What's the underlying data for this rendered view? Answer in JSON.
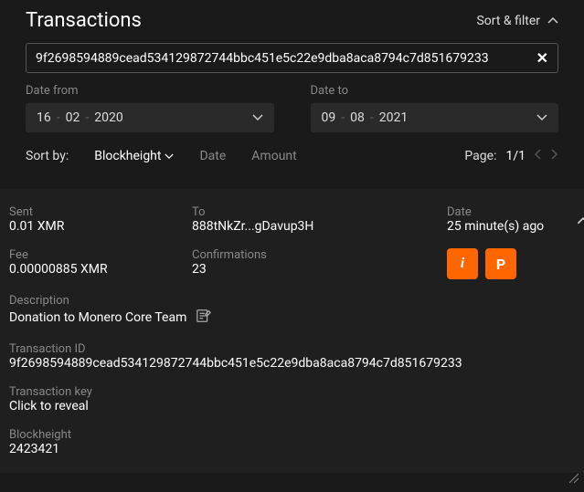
{
  "header": {
    "title": "Transactions",
    "sortFilter": "Sort & filter"
  },
  "search": {
    "value": "9f2698594889cead534129872744bbc451e5c22e9dba8aca8794c7d851679233"
  },
  "dateFrom": {
    "label": "Date from",
    "day": "16",
    "month": "02",
    "year": "2020"
  },
  "dateTo": {
    "label": "Date to",
    "day": "09",
    "month": "08",
    "year": "2021"
  },
  "sort": {
    "label": "Sort by:",
    "options": {
      "blockheight": "Blockheight",
      "date": "Date",
      "amount": "Amount"
    }
  },
  "page": {
    "label": "Page:",
    "value": "1/1"
  },
  "tx": {
    "sentLabel": "Sent",
    "sentValue": "0.01 XMR",
    "toLabel": "To",
    "toValue": "888tNkZr...gDavup3H",
    "dateLabel": "Date",
    "dateValue": "25 minute(s) ago",
    "feeLabel": "Fee",
    "feeValue": "0.00000885 XMR",
    "confLabel": "Confirmations",
    "confValue": "23",
    "descLabel": "Description",
    "descValue": "Donation to Monero Core Team",
    "txidLabel": "Transaction ID",
    "txidValue": "9f2698594889cead534129872744bbc451e5c22e9dba8aca8794c7d851679233",
    "txkeyLabel": "Transaction key",
    "txkeyValue": "Click to reveal",
    "bhLabel": "Blockheight",
    "bhValue": "2423421"
  },
  "icons": {
    "info": "i",
    "proof": "P"
  }
}
